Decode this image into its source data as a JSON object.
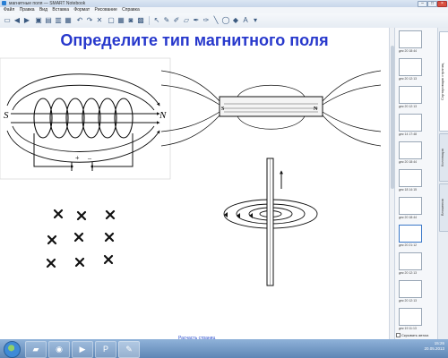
{
  "window": {
    "title": "магнитные поля — SMART Notebook",
    "minimize": "–",
    "maximize": "□",
    "close": "×"
  },
  "menu": [
    "Файл",
    "Правка",
    "Вид",
    "Вставка",
    "Формат",
    "Рисование",
    "Справка"
  ],
  "toolbar": {
    "buttons": [
      "page-icon",
      "next-icon",
      "prev-icon",
      "open-icon",
      "save-icon",
      "paste-icon",
      "undo-icon",
      "redo-icon",
      "delete-icon",
      "screen-icon",
      "table-icon",
      "select-icon",
      "pen-icon",
      "marker-icon",
      "eraser-icon",
      "line-icon",
      "shape-icon",
      "fill-icon",
      "text-icon",
      "properties-icon"
    ]
  },
  "page": {
    "title": "Определите тип магнитного поля",
    "link": "Расчасть страниц"
  },
  "figure_labels": {
    "coil_south": "S",
    "coil_north": "N",
    "plus": "+",
    "minus": "–",
    "magnet_south": "S",
    "magnet_north": "N"
  },
  "sidebar": {
    "tabs": [
      "Сортировщик страниц",
      "Коллекция",
      "Вложения"
    ],
    "thumbnails": [
      {
        "label": "дек 20 18:44"
      },
      {
        "label": "дек 20 12:13"
      },
      {
        "label": "дек 20 12:13"
      },
      {
        "label": "дек 14 17:48"
      },
      {
        "label": "дек 20 18:44"
      },
      {
        "label": "дек 18 14:15"
      },
      {
        "label": "дек 20 18:44"
      },
      {
        "label": "дек 20 21:12"
      },
      {
        "label": "дек 20 12:13"
      },
      {
        "label": "дек 20 12:13"
      },
      {
        "label": "дек 19 11:13"
      }
    ],
    "autohide": "Скрывать автом."
  },
  "taskbar": {
    "apps": [
      "folder-icon",
      "chrome-icon",
      "media-icon",
      "ppt-icon",
      "smart-icon"
    ],
    "time": "15:26",
    "date": "20.05.2013"
  },
  "colors": {
    "title_blue": "#2738cc",
    "link_blue": "#2c4fcf",
    "taskbar": "#5e86b5"
  }
}
